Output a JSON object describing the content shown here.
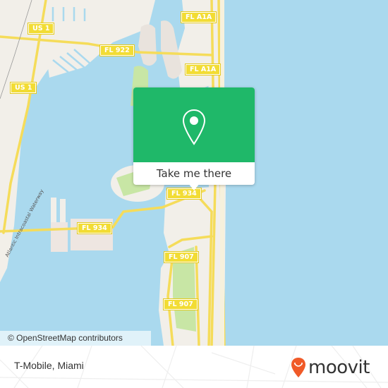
{
  "map": {
    "colors": {
      "water": "#aad9ee",
      "land": "#f2efe9",
      "park": "#c8e6a5",
      "road": "#f5dc5a",
      "shield": "#f2dc34"
    },
    "road_labels": [
      {
        "id": "us1-north",
        "text": "US 1"
      },
      {
        "id": "us1-south",
        "text": "US 1"
      },
      {
        "id": "fl922",
        "text": "FL 922"
      },
      {
        "id": "fla1a-north",
        "text": "FL A1A"
      },
      {
        "id": "fla1a-south",
        "text": "FL A1A"
      },
      {
        "id": "fl934-west",
        "text": "FL 934"
      },
      {
        "id": "fl934-east",
        "text": "FL 934"
      },
      {
        "id": "fl907-north",
        "text": "FL 907"
      },
      {
        "id": "fl907-south",
        "text": "FL 907"
      }
    ],
    "waterway_label": "Atlantic Intracoastal Waterway",
    "attribution": "© OpenStreetMap contributors"
  },
  "popup": {
    "icon": "map-pin-icon",
    "accent": "#1fb869",
    "cta_label": "Take me there"
  },
  "footer": {
    "place_name": "T-Mobile, Miami",
    "brand": "moovit",
    "brand_color": "#f05a28"
  }
}
